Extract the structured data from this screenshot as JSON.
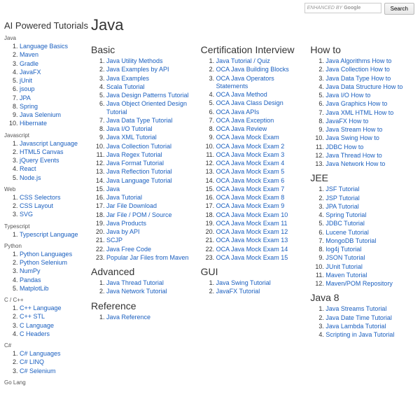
{
  "search": {
    "placeholder_prefix": "ENHANCED BY",
    "placeholder_brand": "Google",
    "button": "Search"
  },
  "sidebar": {
    "title": "AI Powered Tutorials",
    "groups": [
      {
        "name": "Java",
        "items": [
          "Language Basics",
          "Maven",
          "Gradle",
          "JavaFX",
          "jUnit",
          "jsoup",
          "JPA",
          "Spring",
          "Java Selenium",
          "Hibernate"
        ]
      },
      {
        "name": "Javascript",
        "items": [
          "Javascript Language",
          "HTML5 Canvas",
          "jQuery Events",
          "React",
          "Node.js"
        ]
      },
      {
        "name": "Web",
        "items": [
          "CSS Selectors",
          "CSS Layout",
          "SVG"
        ]
      },
      {
        "name": "Typescript",
        "items": [
          "Typescript Language"
        ]
      },
      {
        "name": "Python",
        "items": [
          "Python Languages",
          "Python Selenium",
          "NumPy",
          "Pandas",
          "MatplotLib"
        ]
      },
      {
        "name": "C / C++",
        "items": [
          "C++ Language",
          "C++ STL",
          "C Language",
          "C Headers"
        ]
      },
      {
        "name": "C#",
        "items": [
          "C# Languages",
          "C# LINQ",
          "C# Selenium"
        ]
      },
      {
        "name": "Go Lang",
        "items": []
      }
    ]
  },
  "main": {
    "title": "Java",
    "columns": [
      {
        "sections": [
          {
            "heading": "Basic",
            "items": [
              "Java Utility Methods",
              "Java Examples by API",
              "Java Examples",
              "Scala Tutorial",
              "Java Design Patterns Tutorial",
              "Java Object Oriented Design Tutorial",
              "Java Data Type Tutorial",
              "Java I/O Tutorial",
              "Java XML Tutorial",
              "Java Collection Tutorial",
              "Java Regex Tutorial",
              "Java Format Tutorial",
              "Java Reflection Tutorial",
              "Java Language Tutorial",
              "Java",
              "Java Tutorial",
              "Jar File Download",
              "Jar File / POM / Source",
              "Java Products",
              "Java by API",
              "SCJP",
              "Java Free Code",
              "Popular Jar Files from Maven"
            ]
          },
          {
            "heading": "Advanced",
            "items": [
              "Java Thread Tutorial",
              "Java Network Tutorial"
            ]
          },
          {
            "heading": "Reference",
            "items": [
              "Java Reference"
            ]
          }
        ]
      },
      {
        "sections": [
          {
            "heading": "Certification Interview",
            "items": [
              "Java Tutorial / Quiz",
              "OCA Java Building Blocks",
              "OCA Java Operators Statements",
              "OCA Java Method",
              "OCA Java Class Design",
              "OCA Java APIs",
              "OCA Java Exception",
              "OCA Java Review",
              "OCA Java Mock Exam",
              "OCA Java Mock Exam 2",
              "OCA Java Mock Exam 3",
              "OCA Java Mock Exam 4",
              "OCA Java Mock Exam 5",
              "OCA Java Mock Exam 6",
              "OCA Java Mock Exam 7",
              "OCA Java Mock Exam 8",
              "OCA Java Mock Exam 9",
              "OCA Java Mock Exam 10",
              "OCA Java Mock Exam 11",
              "OCA Java Mock Exam 12",
              "OCA Java Mock Exam 13",
              "OCA Java Mock Exam 14",
              "OCA Java Mock Exam 15"
            ]
          },
          {
            "heading": "GUI",
            "items": [
              "Java Swing Tutorial",
              "JavaFX Tutorial"
            ]
          }
        ]
      },
      {
        "sections": [
          {
            "heading": "How to",
            "items": [
              "Java Algorithms How to",
              "Java Collection How to",
              "Java Data Type How to",
              "Java Data Structure How to",
              "Java I/O How to",
              "Java Graphics How to",
              "Java XML HTML How to",
              "JavaFX How to",
              "Java Stream How to",
              "Java Swing How to",
              "JDBC How to",
              "Java Thread How to",
              "Java Network How to"
            ]
          },
          {
            "heading": "JEE",
            "items": [
              "JSF Tutorial",
              "JSP Tutorial",
              "JPA Tutorial",
              "Spring Tutorial",
              "JDBC Tutorial",
              "Lucene Tutorial",
              "MongoDB Tutorial",
              "log4j Tutorial",
              "JSON Tutorial",
              "JUnit Tutorial",
              "Maven Tutorial",
              "Maven/POM Repository"
            ]
          },
          {
            "heading": "Java 8",
            "items": [
              "Java Streams Tutorial",
              "Java Date Time Tutorial",
              "Java Lambda Tutorial",
              "Scripting in Java Tutorial"
            ]
          }
        ]
      }
    ]
  }
}
